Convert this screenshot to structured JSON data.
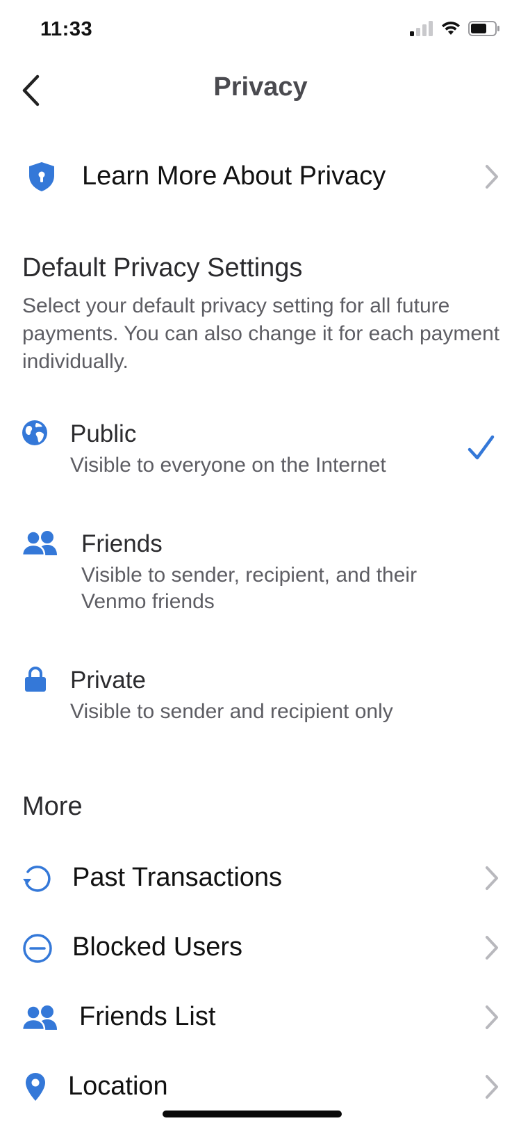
{
  "status_bar": {
    "time": "11:33"
  },
  "nav": {
    "title": "Privacy",
    "back_icon": "chevron-left-icon"
  },
  "learn_more": {
    "label": "Learn More About Privacy",
    "icon": "shield-lock-icon"
  },
  "default_privacy": {
    "title": "Default Privacy Settings",
    "description": "Select your default privacy setting for all future payments. You can also change it for each payment individually.",
    "options": [
      {
        "title": "Public",
        "description": "Visible to everyone on the Internet",
        "icon": "globe-icon",
        "selected": true
      },
      {
        "title": "Friends",
        "description": "Visible to sender, recipient, and their Venmo friends",
        "icon": "friends-icon",
        "selected": false
      },
      {
        "title": "Private",
        "description": "Visible to sender and recipient only",
        "icon": "lock-icon",
        "selected": false
      }
    ]
  },
  "more": {
    "title": "More",
    "items": [
      {
        "label": "Past Transactions",
        "icon": "history-icon"
      },
      {
        "label": "Blocked Users",
        "icon": "blocked-icon"
      },
      {
        "label": "Friends List",
        "icon": "friends-icon"
      },
      {
        "label": "Location",
        "icon": "location-pin-icon"
      }
    ]
  },
  "colors": {
    "accent": "#3478d8",
    "text_primary": "#111111",
    "text_secondary": "#5d5d63",
    "chevron": "#b8b8bd"
  }
}
